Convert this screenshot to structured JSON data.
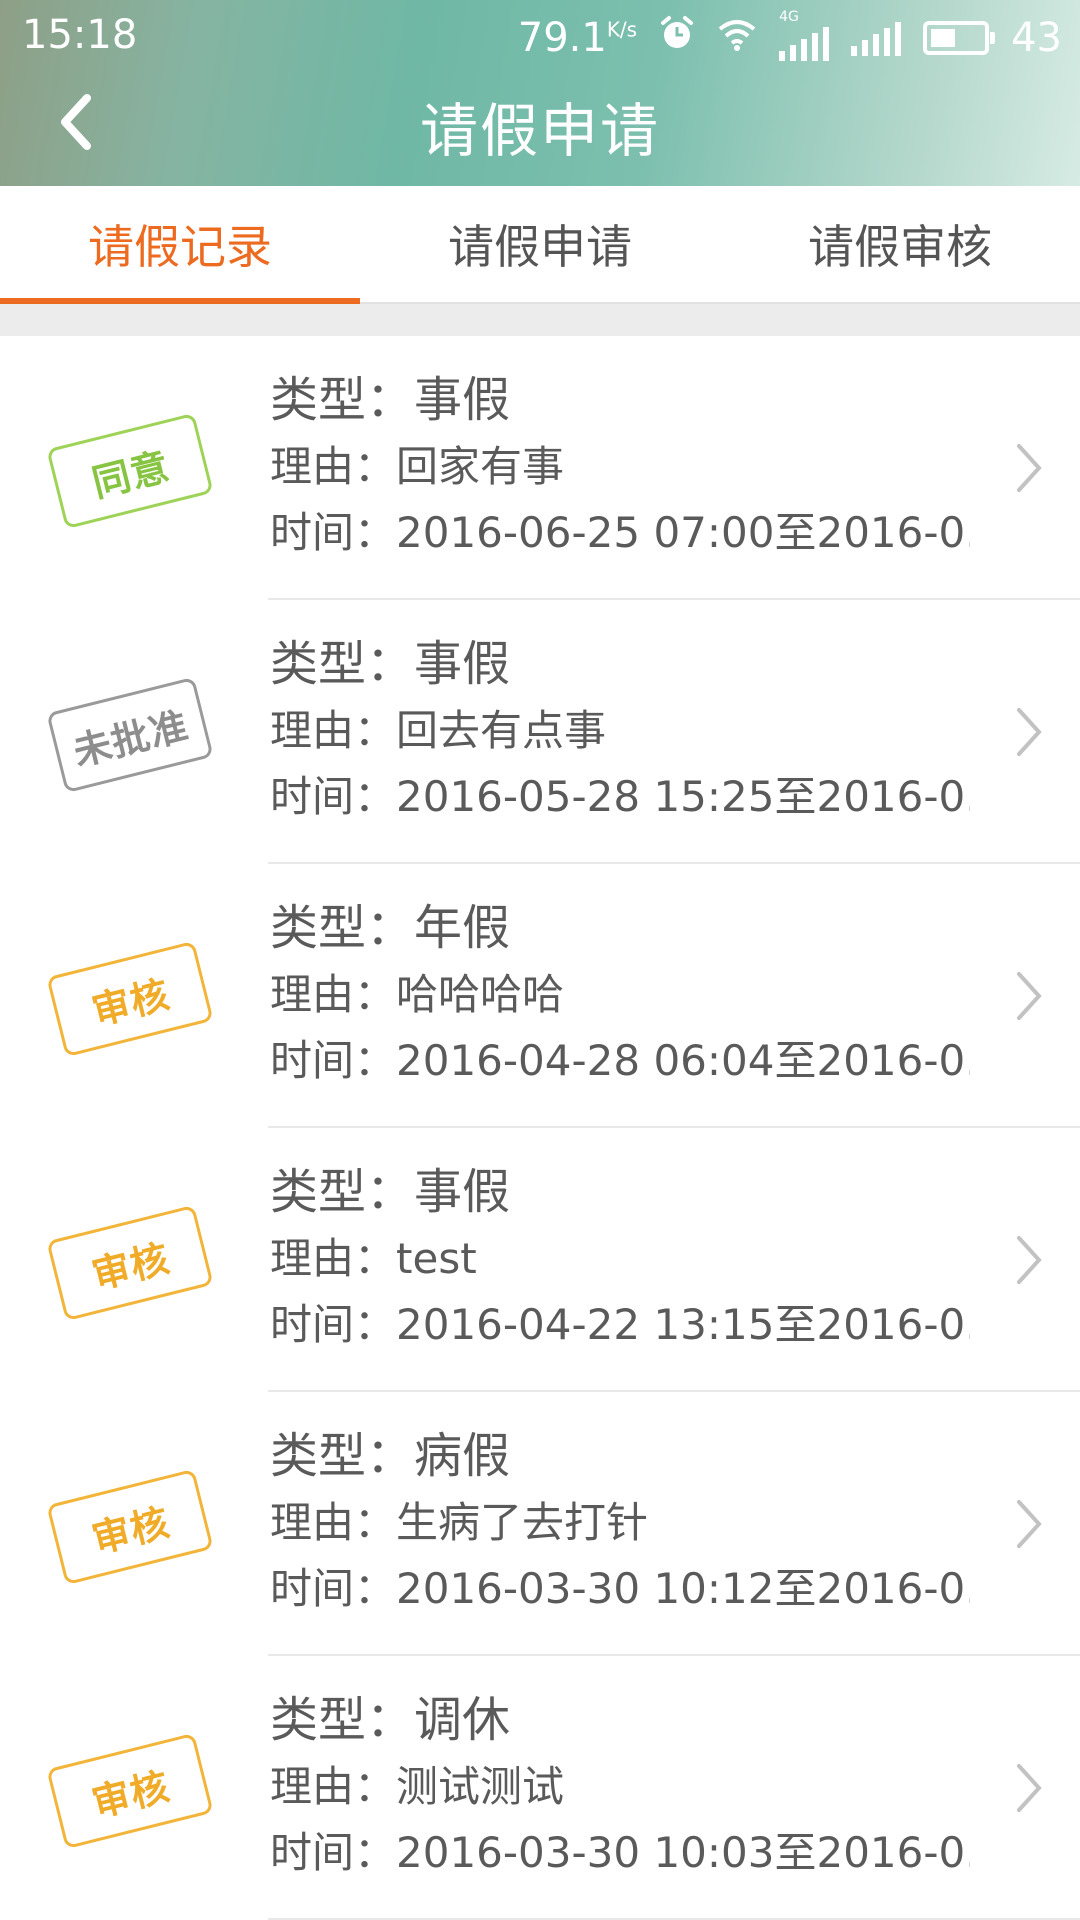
{
  "status_bar": {
    "time": "15:18",
    "net_speed": "79.1",
    "net_speed_unit": "K/s",
    "network_type": "4G",
    "battery": "43",
    "icons": [
      "alarm-icon",
      "wifi-icon",
      "signal-4g-icon",
      "signal-icon",
      "battery-icon"
    ]
  },
  "header": {
    "title": "请假申请",
    "back_icon": "chevron-left-icon"
  },
  "tabs": [
    {
      "label": "请假记录",
      "active": true
    },
    {
      "label": "请假申请",
      "active": false
    },
    {
      "label": "请假审核",
      "active": false
    }
  ],
  "colors": {
    "accent": "#ec6b20",
    "approved": "#86c441",
    "rejected": "#8d8d8d",
    "pending": "#f0ab28"
  },
  "records": [
    {
      "status": "approved",
      "stamp": "同意",
      "type_prefix": "类型：",
      "type": "事假",
      "reason_prefix": "理由：",
      "reason": "回家有事",
      "time_prefix": "时间：",
      "time": "2016-06-25 07:00至2016-0..."
    },
    {
      "status": "rejected",
      "stamp": "未批准",
      "type_prefix": "类型：",
      "type": "事假",
      "reason_prefix": "理由：",
      "reason": "回去有点事",
      "time_prefix": "时间：",
      "time": "2016-05-28 15:25至2016-0..."
    },
    {
      "status": "pending",
      "stamp": "审核",
      "type_prefix": "类型：",
      "type": "年假",
      "reason_prefix": "理由：",
      "reason": "哈哈哈哈",
      "time_prefix": "时间：",
      "time": "2016-04-28 06:04至2016-0..."
    },
    {
      "status": "pending",
      "stamp": "审核",
      "type_prefix": "类型：",
      "type": "事假",
      "reason_prefix": "理由：",
      "reason": "test",
      "time_prefix": "时间：",
      "time": "2016-04-22 13:15至2016-0..."
    },
    {
      "status": "pending",
      "stamp": "审核",
      "type_prefix": "类型：",
      "type": "病假",
      "reason_prefix": "理由：",
      "reason": "生病了去打针",
      "time_prefix": "时间：",
      "time": "2016-03-30 10:12至2016-0..."
    },
    {
      "status": "pending",
      "stamp": "审核",
      "type_prefix": "类型：",
      "type": "调休",
      "reason_prefix": "理由：",
      "reason": "测试测试",
      "time_prefix": "时间：",
      "time": "2016-03-30 10:03至2016-0..."
    }
  ]
}
